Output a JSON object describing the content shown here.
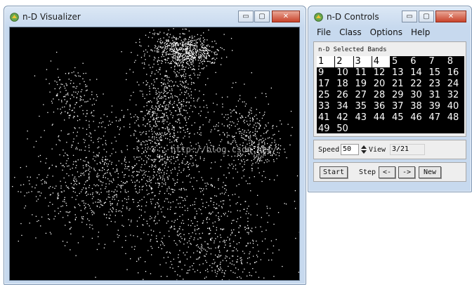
{
  "visualizer": {
    "title": "n-D Visualizer",
    "minimize": "▭",
    "maximize": "▢",
    "close": "✕"
  },
  "controls": {
    "title": "n-D Controls",
    "minimize": "▭",
    "maximize": "▢",
    "close": "✕",
    "menu": [
      "File",
      "Class",
      "Options",
      "Help"
    ],
    "bands_label": "n-D Selected Bands",
    "bands": [
      {
        "n": "1",
        "sel": true
      },
      {
        "n": "2",
        "sel": true
      },
      {
        "n": "3",
        "sel": true
      },
      {
        "n": "4",
        "sel": true
      },
      {
        "n": "5",
        "sel": false
      },
      {
        "n": "6",
        "sel": false
      },
      {
        "n": "7",
        "sel": false
      },
      {
        "n": "8",
        "sel": false
      },
      {
        "n": "9",
        "sel": false
      },
      {
        "n": "10",
        "sel": false
      },
      {
        "n": "11",
        "sel": false
      },
      {
        "n": "12",
        "sel": false
      },
      {
        "n": "13",
        "sel": false
      },
      {
        "n": "14",
        "sel": false
      },
      {
        "n": "15",
        "sel": false
      },
      {
        "n": "16",
        "sel": false
      },
      {
        "n": "17",
        "sel": false
      },
      {
        "n": "18",
        "sel": false
      },
      {
        "n": "19",
        "sel": false
      },
      {
        "n": "20",
        "sel": false
      },
      {
        "n": "21",
        "sel": false
      },
      {
        "n": "22",
        "sel": false
      },
      {
        "n": "23",
        "sel": false
      },
      {
        "n": "24",
        "sel": false
      },
      {
        "n": "25",
        "sel": false
      },
      {
        "n": "26",
        "sel": false
      },
      {
        "n": "27",
        "sel": false
      },
      {
        "n": "28",
        "sel": false
      },
      {
        "n": "29",
        "sel": false
      },
      {
        "n": "30",
        "sel": false
      },
      {
        "n": "31",
        "sel": false
      },
      {
        "n": "32",
        "sel": false
      },
      {
        "n": "33",
        "sel": false
      },
      {
        "n": "34",
        "sel": false
      },
      {
        "n": "35",
        "sel": false
      },
      {
        "n": "36",
        "sel": false
      },
      {
        "n": "37",
        "sel": false
      },
      {
        "n": "38",
        "sel": false
      },
      {
        "n": "39",
        "sel": false
      },
      {
        "n": "40",
        "sel": false
      },
      {
        "n": "41",
        "sel": false
      },
      {
        "n": "42",
        "sel": false
      },
      {
        "n": "43",
        "sel": false
      },
      {
        "n": "44",
        "sel": false
      },
      {
        "n": "45",
        "sel": false
      },
      {
        "n": "46",
        "sel": false
      },
      {
        "n": "47",
        "sel": false
      },
      {
        "n": "48",
        "sel": false
      },
      {
        "n": "49",
        "sel": false
      },
      {
        "n": "50",
        "sel": false
      }
    ],
    "speed_label": "Speed",
    "speed_value": "50",
    "view_label": "View",
    "view_value": "3/21",
    "start_label": "Start",
    "step_label": "Step",
    "prev_label": "<-",
    "next_label": "->",
    "new_label": "New"
  },
  "watermark": "http://blog.csdn.net/"
}
